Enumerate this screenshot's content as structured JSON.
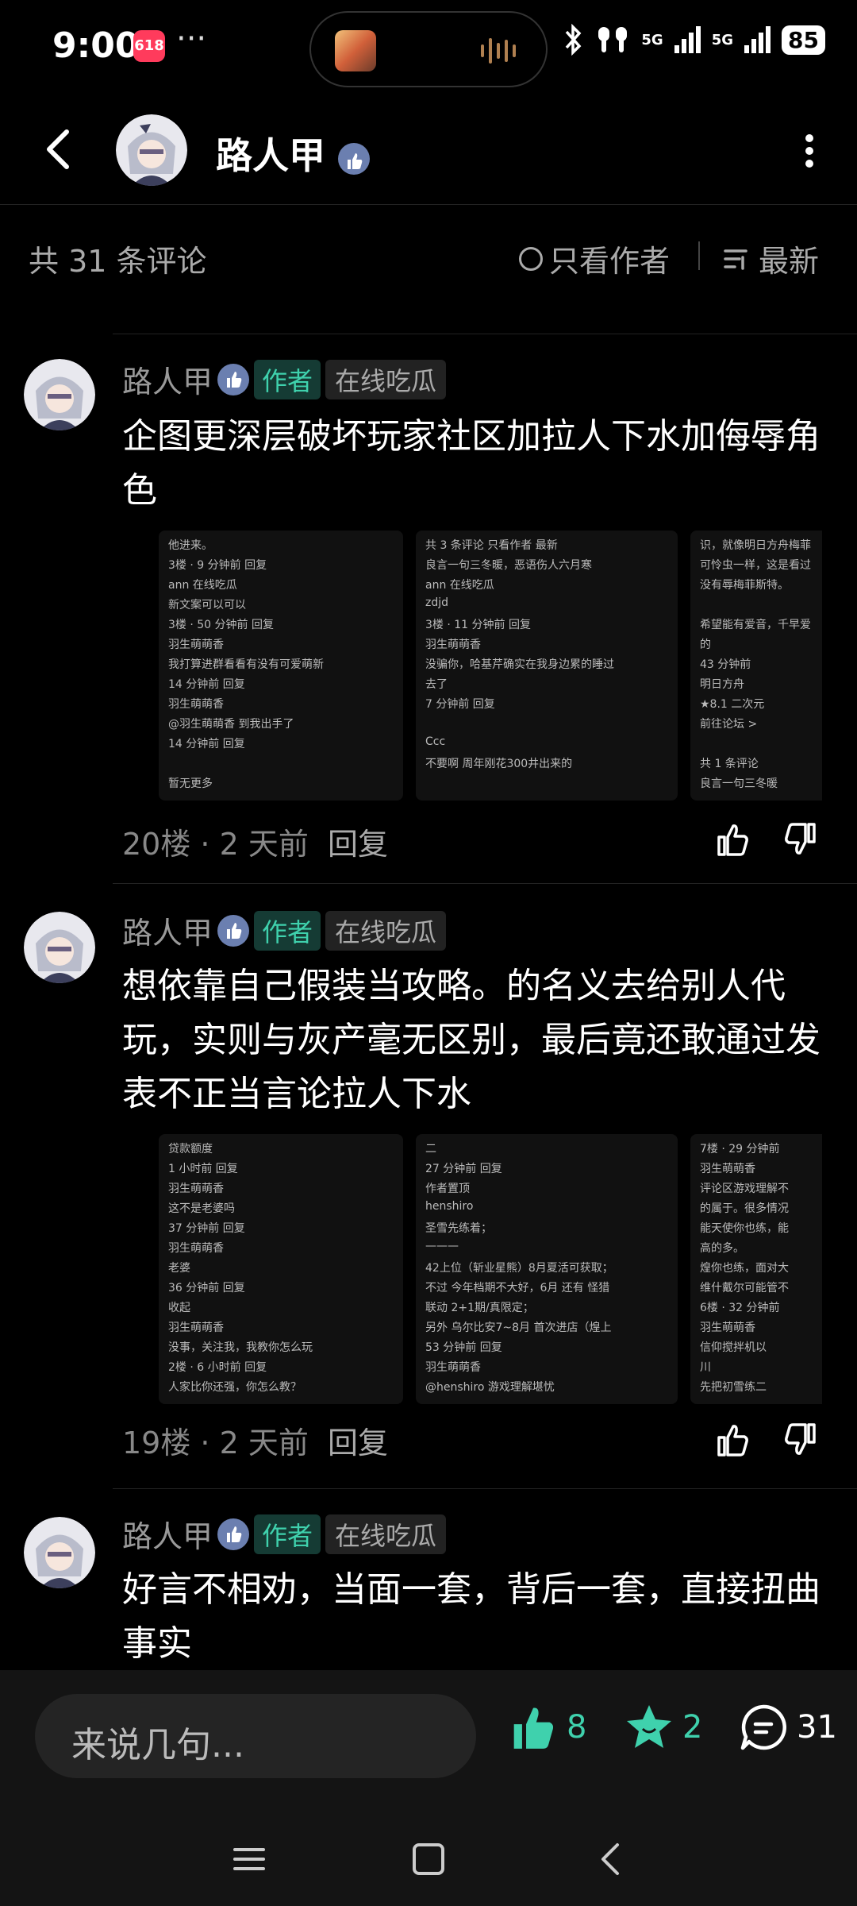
{
  "status": {
    "time": "9:00",
    "app_badge": "618",
    "more": "···",
    "network1": "5G",
    "network2": "5G",
    "battery": "85"
  },
  "header": {
    "title": "路人甲"
  },
  "sort": {
    "count": "共 31 条评论",
    "only_author": "只看作者",
    "latest": "最新"
  },
  "comments": [
    {
      "name": "路人甲",
      "author_badge": "作者",
      "tag": "在线吃瓜",
      "text": "企图更深层破坏玩家社区加拉人下水加侮辱角色",
      "floor": "20楼 · 2 天前",
      "reply": "回复",
      "shots": [
        [
          "他进来。",
          "3楼 · 9 分钟前  回复",
          "ann 在线吃瓜",
          "新文案可以可以",
          "3楼 · 50 分钟前  回复",
          "羽生萌萌香",
          "我打算进群看看有没有可爱萌新",
          "14 分钟前  回复",
          "羽生萌萌香",
          "@羽生萌萌香  到我出手了",
          "14 分钟前  回复",
          "",
          "暂无更多"
        ],
        [
          "共 3 条评论       只看作者    最新",
          "良言一句三冬暖，恶语伤人六月寒",
          "ann 在线吃瓜",
          "zdjd",
          "3楼 · 11 分钟前  回复",
          "羽生萌萌香",
          "没骗你，哈基芹确实在我身边累的睡过",
          "去了",
          "7 分钟前  回复",
          "",
          "Ccc",
          "不要啊 周年刚花300井出来的"
        ],
        [
          "识，就像明日方舟梅菲",
          "可怜虫一样，这是看过",
          "没有辱梅菲斯特。",
          "",
          "希望能有爱音，千早爱",
          "的",
          "43 分钟前",
          "明日方舟",
          "★8.1 二次元",
          "前往论坛 >",
          "",
          "共 1 条评论",
          "良言一句三冬暖"
        ]
      ]
    },
    {
      "name": "路人甲",
      "author_badge": "作者",
      "tag": "在线吃瓜",
      "text": "想依靠自己假装当攻略。的名义去给别人代玩，实则与灰产毫无区别，最后竟还敢通过发表不正当言论拉人下水",
      "floor": "19楼 · 2 天前",
      "reply": "回复",
      "shots": [
        [
          "贷款额度",
          "1 小时前  回复",
          "羽生萌萌香",
          "这不是老婆吗",
          "37 分钟前  回复",
          "羽生萌萌香",
          "老婆",
          "36 分钟前  回复",
          "收起",
          "羽生萌萌香",
          "没事，关注我，我教你怎么玩",
          "2楼 · 6 小时前  回复",
          "人家比你还强，你怎么教？"
        ],
        [
          "二",
          "27 分钟前  回复",
          "作者置顶",
          "henshiro",
          "圣雪先练着；",
          "———",
          "42上位（斩业星熊）8月夏活可获取；",
          "不过 今年档期不大好，6月 还有 怪猎",
          "联动 2+1期/真限定；",
          "另外 乌尔比安7~8月 首次进店（煌上",
          "53 分钟前  回复",
          "羽生萌萌香",
          "@henshiro  游戏理解堪忧"
        ],
        [
          "7楼 · 29 分钟前",
          "羽生萌萌香",
          "评论区游戏理解不",
          "的属于。很多情况",
          "能天使你也练，能",
          "高的多。",
          "煌你也练，面对大",
          "维什戴尔可能管不",
          "6楼 · 32 分钟前",
          "羽生萌萌香",
          "信仰搅拌机以",
          "川",
          "先把初雪练二"
        ]
      ]
    },
    {
      "name": "路人甲",
      "author_badge": "作者",
      "tag": "在线吃瓜",
      "text": "好言不相劝，当面一套，背后一套，直接扭曲事实"
    }
  ],
  "bottom": {
    "input_placeholder": "来说几句...",
    "likes": "8",
    "stars": "2",
    "comments": "31"
  },
  "colors": {
    "accent": "#3fd1ad",
    "background": "#000000",
    "bar": "#141414"
  }
}
